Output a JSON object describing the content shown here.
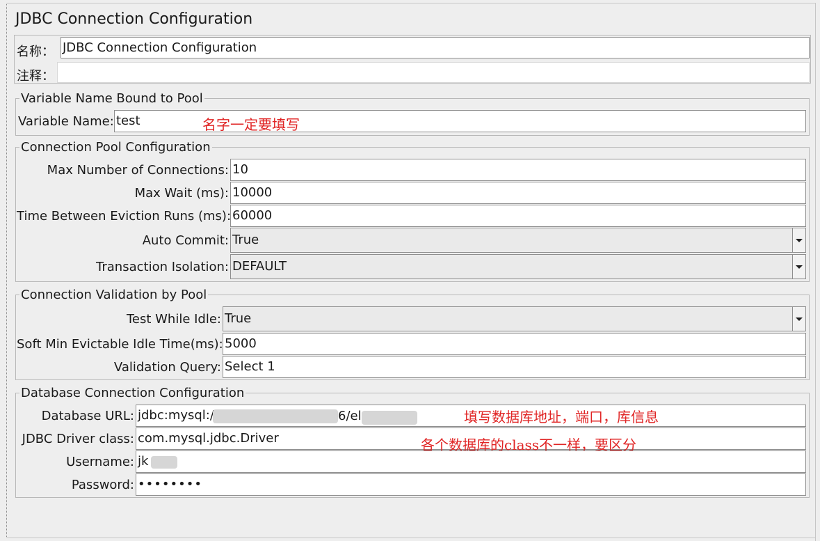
{
  "panel": {
    "title": "JDBC Connection Configuration"
  },
  "name_section": {
    "name_label": "名称：",
    "name_value": "JDBC Connection Configuration",
    "comment_label": "注释：",
    "comment_value": ""
  },
  "variable_group": {
    "title": "Variable Name Bound to Pool",
    "variable_name_label": "Variable Name:",
    "variable_name_value": "test",
    "annotation": "名字一定要填写"
  },
  "pool_group": {
    "title": "Connection Pool Configuration",
    "max_connections_label": "Max Number of Connections:",
    "max_connections_value": "10",
    "max_wait_label": "Max Wait (ms):",
    "max_wait_value": "10000",
    "eviction_label": "Time Between Eviction Runs (ms):",
    "eviction_value": "60000",
    "auto_commit_label": "Auto Commit:",
    "auto_commit_value": "True",
    "isolation_label": "Transaction Isolation:",
    "isolation_value": "DEFAULT"
  },
  "validation_group": {
    "title": "Connection Validation by Pool",
    "test_idle_label": "Test While Idle:",
    "test_idle_value": "True",
    "soft_min_label": "Soft Min Evictable Idle Time(ms):",
    "soft_min_value": "5000",
    "query_label": "Validation Query:",
    "query_value": "Select 1"
  },
  "database_group": {
    "title": "Database Connection Configuration",
    "url_label": "Database URL:",
    "url_value_part1": "jdbc:mysql://",
    "url_value_part2": "6/el",
    "url_annotation": "填写数据库地址，端口，库信息",
    "driver_label": "JDBC Driver class:",
    "driver_value": "com.mysql.jdbc.Driver",
    "driver_annotation": "各个数据库的class不一样，要区分",
    "username_label": "Username:",
    "username_value": "jk",
    "password_label": "Password:",
    "password_value": "••••••••"
  },
  "colors": {
    "annotation": "#e02424",
    "background": "#eeeeee"
  }
}
